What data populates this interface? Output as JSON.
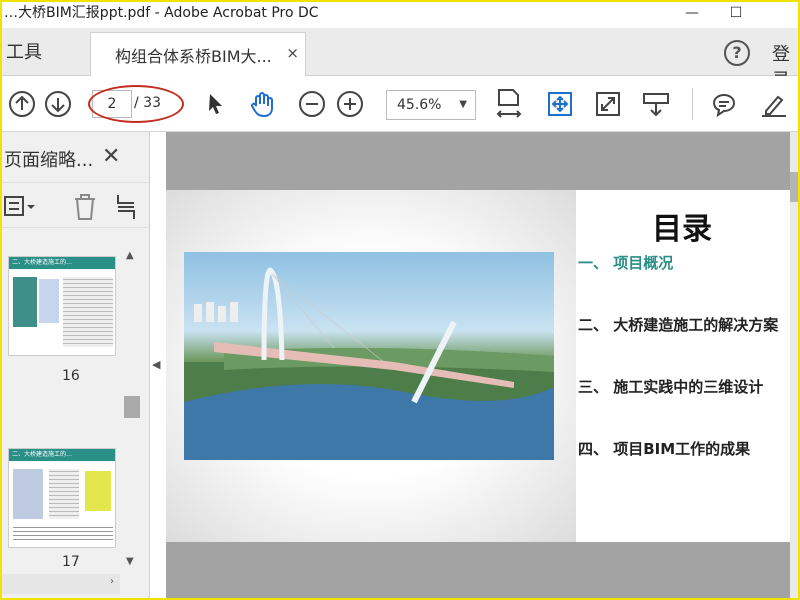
{
  "window": {
    "title": "…大桥BIM汇报ppt.pdf - Adobe Acrobat Pro DC",
    "minimize": "—",
    "maximize": "☐"
  },
  "tabs": {
    "tools_label": "工具",
    "document_label": "构组合体系桥BIM大...",
    "close": "×",
    "help": "?",
    "login": "登录"
  },
  "toolbar": {
    "current_page": "2",
    "page_count": "/ 33",
    "zoom": "45.6%"
  },
  "sidebar": {
    "title": "页面缩略...",
    "close": "✕",
    "thumbnails": [
      {
        "page_label": "16",
        "heading": "二、大桥建造施工的…"
      },
      {
        "page_label": "17",
        "heading": "二、大桥建造施工的…"
      }
    ]
  },
  "slide": {
    "toc_title": "目录",
    "items": [
      {
        "text": "一、 项目概况",
        "active": true
      },
      {
        "text": "二、 大桥建造施工的解决方案",
        "active": false
      },
      {
        "text": "三、 施工实践中的三维设计",
        "active": false
      },
      {
        "text": "四、 项目BIM工作的成果",
        "active": false
      }
    ]
  },
  "colors": {
    "active_toc": "#2a8f87",
    "highlight_oval": "#c62b1f",
    "frame_border": "#f2e200",
    "accent_blue": "#1f6fd1"
  }
}
